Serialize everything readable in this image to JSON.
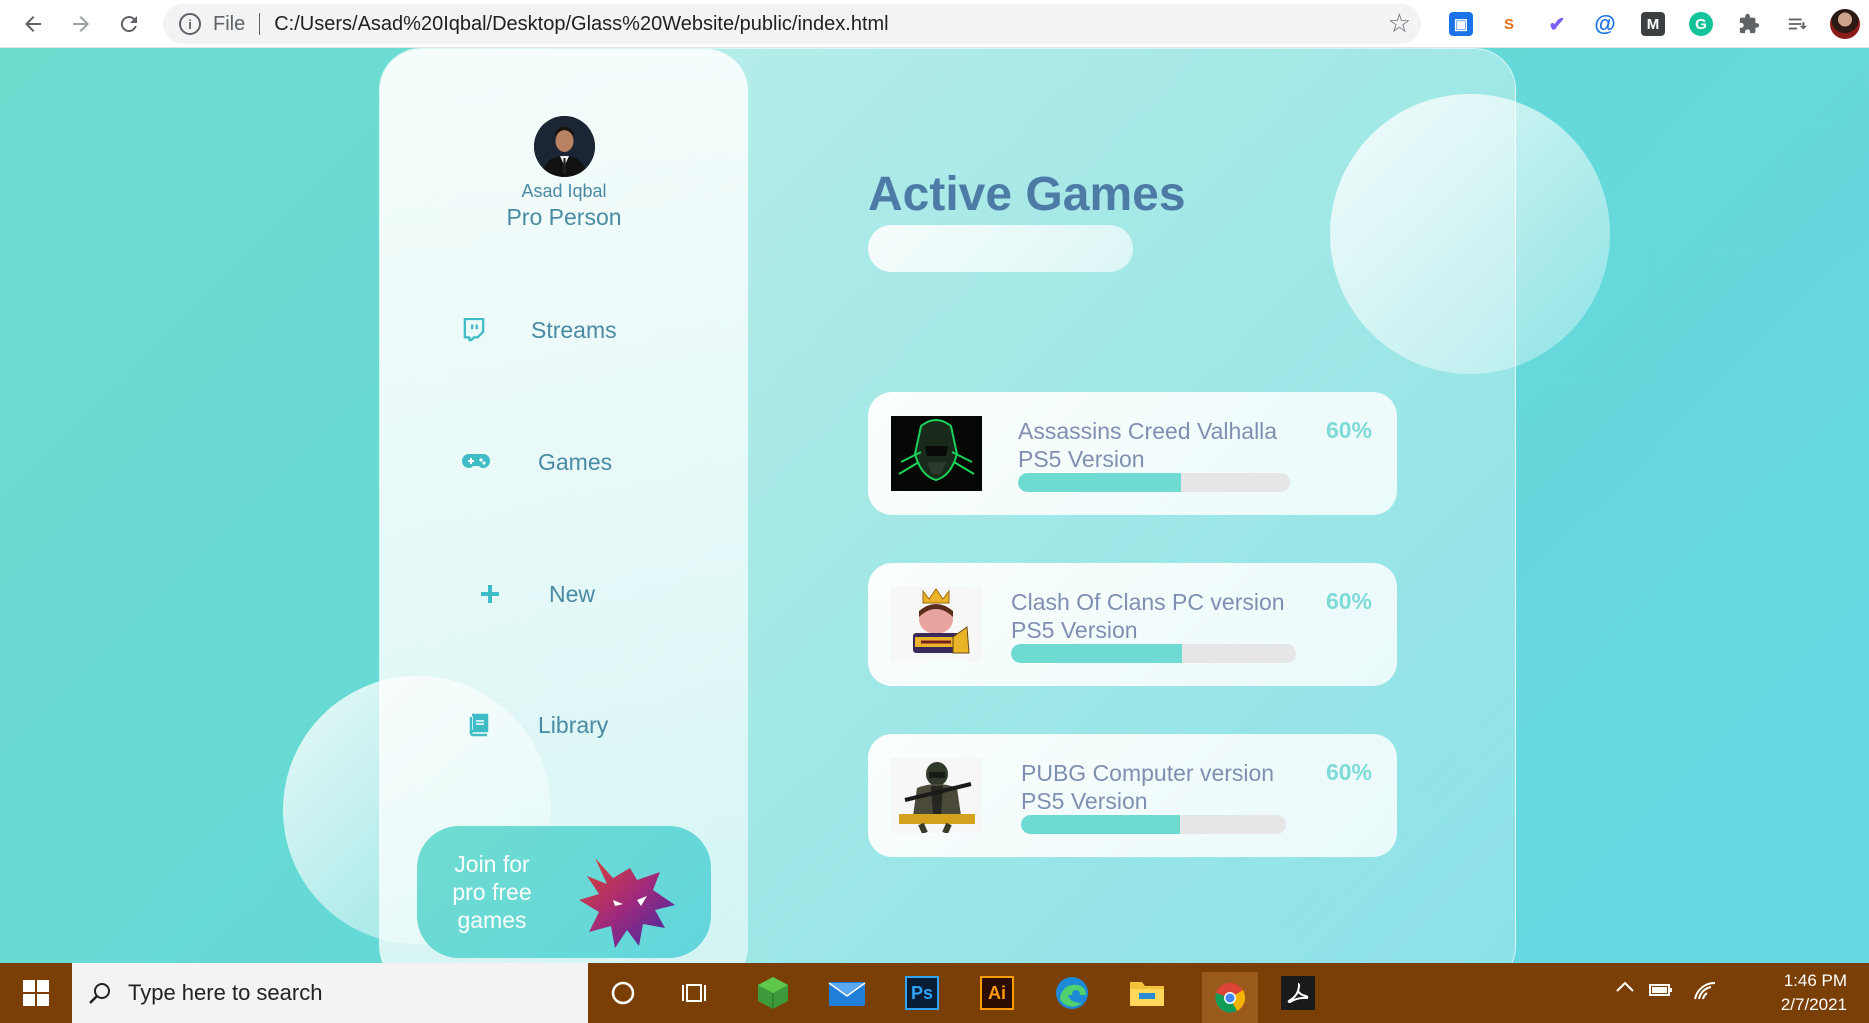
{
  "browser": {
    "scheme_label": "File",
    "url": "C:/Users/Asad%20Iqbal/Desktop/Glass%20Website/public/index.html",
    "extensions": [
      "screen-capture-icon",
      "so-extension-icon",
      "checkmark-extension-icon",
      "at-sign-extension-icon",
      "mailtrack-icon",
      "grammarly-icon",
      "extensions-puzzle-icon",
      "reading-list-icon",
      "profile-avatar"
    ]
  },
  "profile": {
    "name": "Asad Iqbal",
    "role": "Pro Person"
  },
  "menu": [
    {
      "label": "Streams",
      "icon": "twitch-icon"
    },
    {
      "label": "Games",
      "icon": "gamepad-icon"
    },
    {
      "label": "New",
      "icon": "plus-icon"
    },
    {
      "label": "Library",
      "icon": "book-icon"
    }
  ],
  "promo": {
    "text_line1": "Join for",
    "text_line2": "pro free",
    "text_line3": "games"
  },
  "main": {
    "title": "Active Games"
  },
  "games": [
    {
      "title": "Assassins Creed Valhalla",
      "subtitle": "PS5 Version",
      "percent_label": "60%",
      "progress": 0.6
    },
    {
      "title": "Clash Of Clans PC version",
      "subtitle": "PS5 Version",
      "percent_label": "60%",
      "progress": 0.6
    },
    {
      "title": "PUBG Computer version",
      "subtitle": "PS5 Version",
      "percent_label": "60%",
      "progress": 0.6
    }
  ],
  "taskbar": {
    "search_placeholder": "Type here to search",
    "time": "1:46 PM",
    "date": "2/7/2021",
    "apps": [
      "cortana-icon",
      "task-view-icon",
      "minecraft-icon",
      "mail-icon",
      "photoshop-icon",
      "illustrator-icon",
      "edge-icon",
      "file-explorer-icon",
      "chrome-icon",
      "acrobat-icon"
    ],
    "ps_label": "Ps",
    "ai_label": "Ai"
  },
  "colors": {
    "background": "#66d8d6",
    "accent_text": "#4a8aa3",
    "title": "#4e7ba6",
    "progress": "#6ddbd2",
    "taskbar": "#7a3f05"
  }
}
